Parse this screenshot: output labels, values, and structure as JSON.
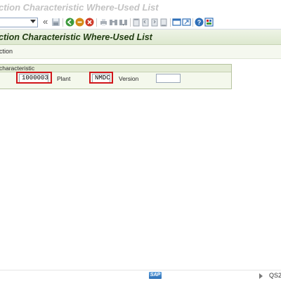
{
  "window": {
    "title": "ction Characteristic Where-Used List"
  },
  "toolbar": {
    "command_value": "",
    "icons": [
      "back-icon",
      "exit-icon",
      "cancel-icon",
      "print-icon",
      "find-icon",
      "find-next-icon",
      "first-page-icon",
      "prev-page-icon",
      "next-page-icon",
      "last-page-icon",
      "new-session-icon",
      "shortcut-icon",
      "help-icon",
      "layout-icon"
    ],
    "double_arrow": "«"
  },
  "app": {
    "title": "ction Characteristic Where-Used List"
  },
  "section": {
    "label": "ction"
  },
  "group": {
    "title": "characteristic",
    "characteristic_value": "1000003",
    "plant_label": "Plant",
    "plant_value": "NMDC",
    "version_label": "Version",
    "version_value": ""
  },
  "status": {
    "logo": "SAP",
    "system": "QS2("
  },
  "colors": {
    "highlight": "#d1161b",
    "app_bar": "#dde8cf",
    "group_bg": "#f4f8ec"
  }
}
